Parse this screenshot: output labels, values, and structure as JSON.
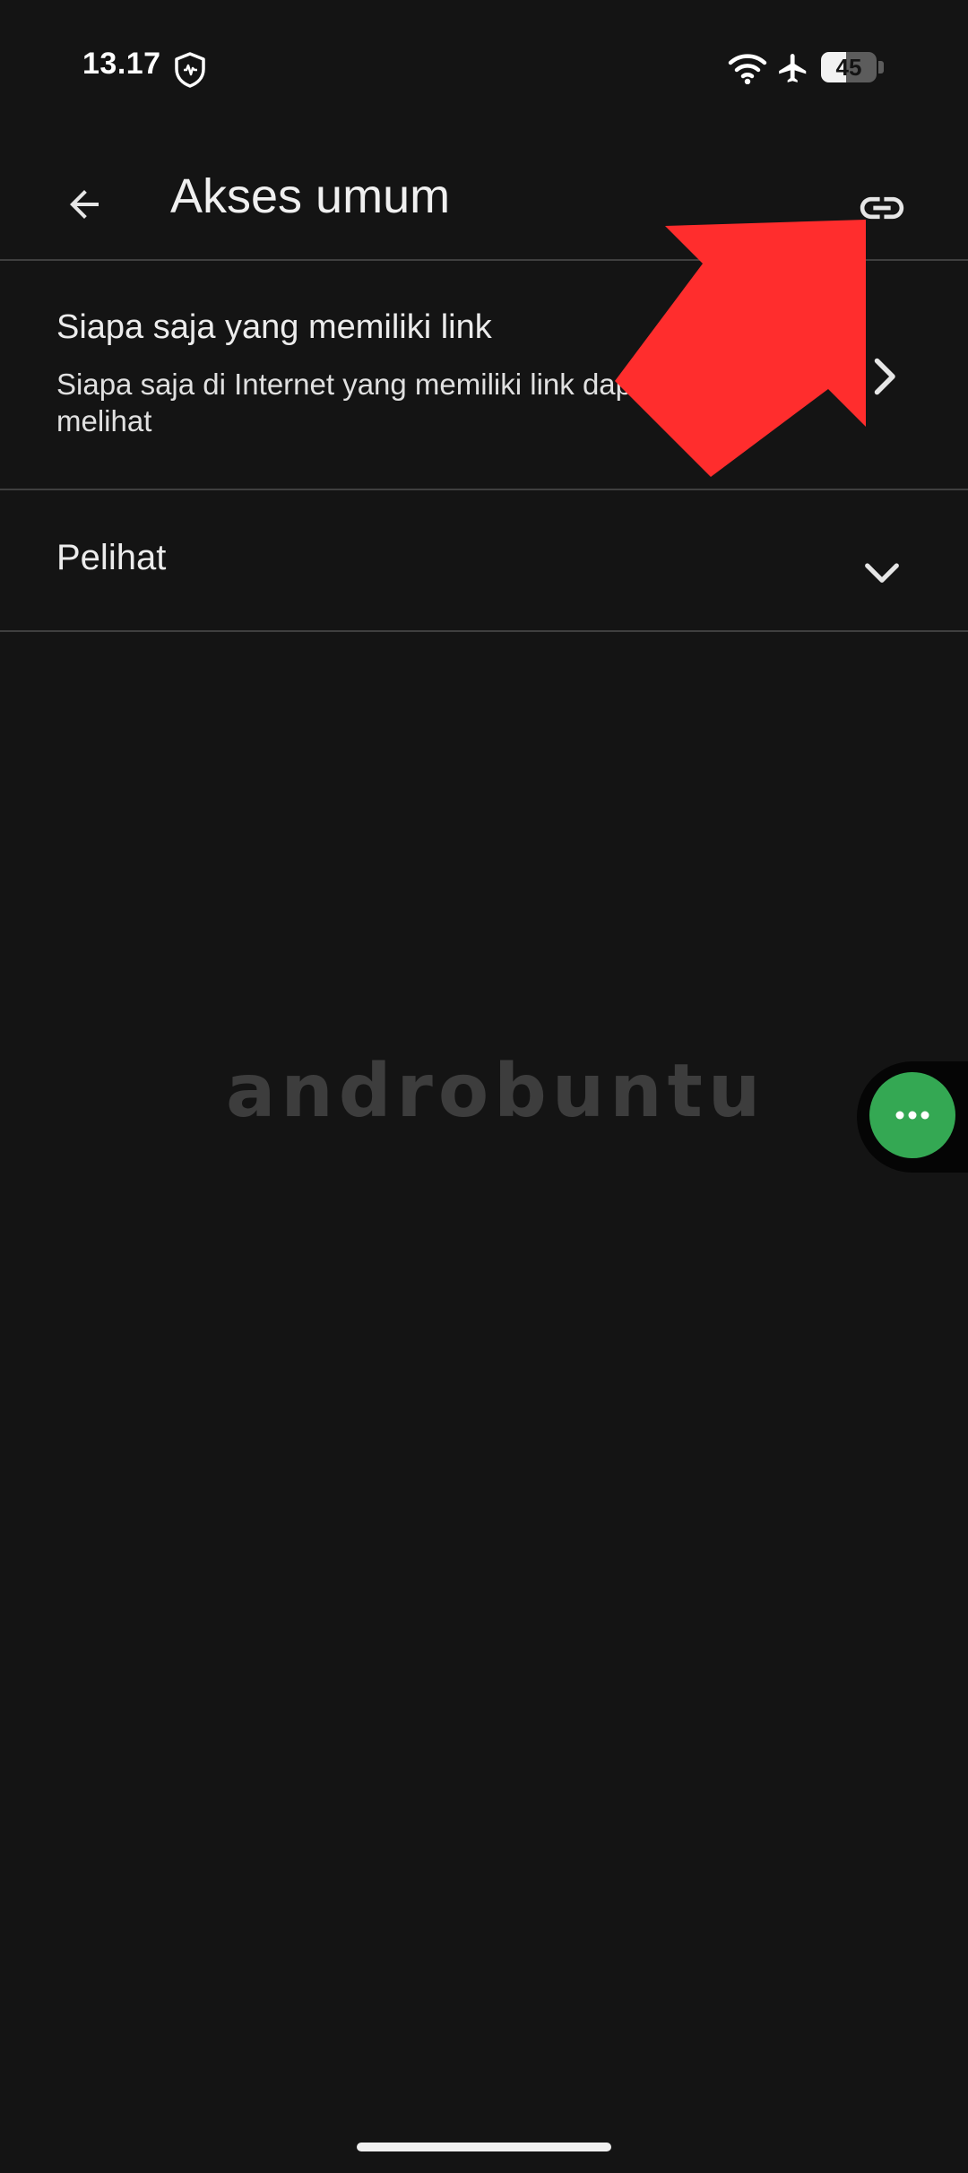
{
  "status_bar": {
    "time": "13.17",
    "battery_percent": "45",
    "icons": [
      "shield-icon",
      "wifi-icon",
      "airplane-icon",
      "battery-icon"
    ]
  },
  "app_bar": {
    "title": "Akses umum",
    "back_icon": "arrow-back-icon",
    "action_icon": "link-icon"
  },
  "general_access": {
    "title": "Siapa saja yang memiliki link",
    "subtitle": "Siapa saja di Internet yang memiliki link dapat melihat"
  },
  "role": {
    "label": "Pelihat"
  },
  "watermark": "androbuntu",
  "floating_button": {
    "icon": "more-horiz-icon",
    "color": "#34a853"
  },
  "annotation": {
    "color": "#ff2d2d"
  },
  "colors": {
    "background": "#141414",
    "divider": "#3f3f3f",
    "text": "#e8e8e8"
  }
}
